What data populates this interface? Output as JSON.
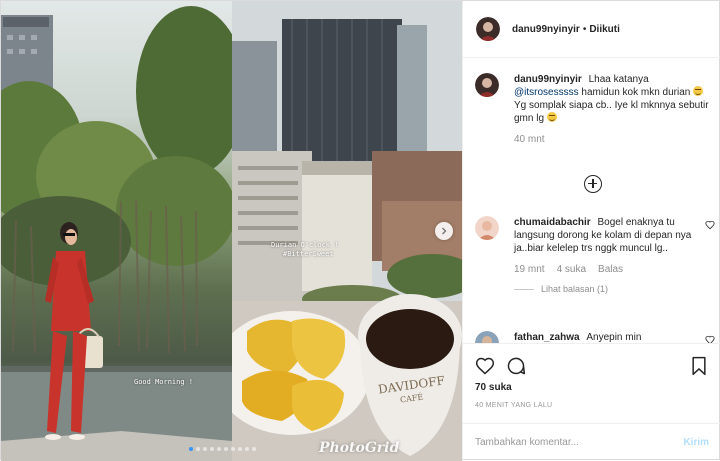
{
  "header": {
    "username": "danu99nyinyir",
    "separator": "•",
    "follow_status": "Diikuti"
  },
  "media": {
    "overlay_good_morning": "Good Morning !",
    "overlay_durian": "Durian O'clock !",
    "overlay_hashtag": "#BitterSweet",
    "watermark": "PhotoGrid",
    "carousel_total": 10,
    "carousel_active": 1,
    "icons": {
      "next": "chevron-right-icon"
    }
  },
  "caption": {
    "username": "danu99nyinyir",
    "text_before": "Lhaa katanya",
    "mention": "@itsrosesssss",
    "text_after": "hamidun kok mkn durian",
    "line2": "Yg somplak siapa cb.. Iye kl mknnya sebutir gmn lg",
    "time": "40 mnt"
  },
  "comments": [
    {
      "username": "chumaidabachir",
      "text": "Bogel enaknya tu langsung dorong ke kolam di depan nya ja..biar kelelep trs nggk muncul lg..",
      "time": "19 mnt",
      "likes": "4 suka",
      "reply_label": "Balas",
      "view_replies": "Lihat balasan (1)"
    },
    {
      "username": "fathan_zahwa",
      "text": "Anyepin min"
    }
  ],
  "actions": {
    "icons": [
      "heart-icon",
      "comment-icon",
      "bookmark-icon",
      "plus-circle-icon"
    ],
    "likes": "70 suka",
    "posted": "40 MENIT YANG LALU"
  },
  "add_comment": {
    "placeholder": "Tambahkan komentar...",
    "send_label": "Kirim"
  },
  "colors": {
    "text": "#262626",
    "muted": "#8e8e8e",
    "link": "#003569",
    "send_disabled": "#b2dffc",
    "border": "#efefef"
  }
}
